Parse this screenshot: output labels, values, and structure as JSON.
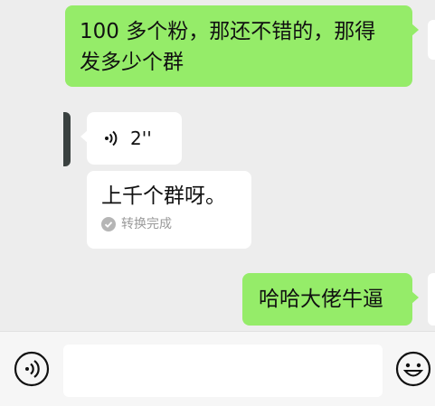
{
  "messages": [
    {
      "type": "text",
      "side": "right",
      "text_line1": "100 多个粉，那还不错的，那得",
      "text_line2": "发多少个群"
    },
    {
      "type": "voice",
      "side": "left",
      "duration": "2''",
      "transcript": "上千个群呀。",
      "transcript_status": "转换完成"
    },
    {
      "type": "text",
      "side": "right",
      "text": "哈哈大佬牛逼"
    }
  ],
  "input_bar": {
    "voice_button_icon": "voice-icon",
    "emoji_button_icon": "emoji-icon",
    "input_value": ""
  },
  "colors": {
    "background": "#ededed",
    "sent_bubble": "#95ec69",
    "received_bubble": "#ffffff",
    "status_text": "#9a9a9a"
  }
}
